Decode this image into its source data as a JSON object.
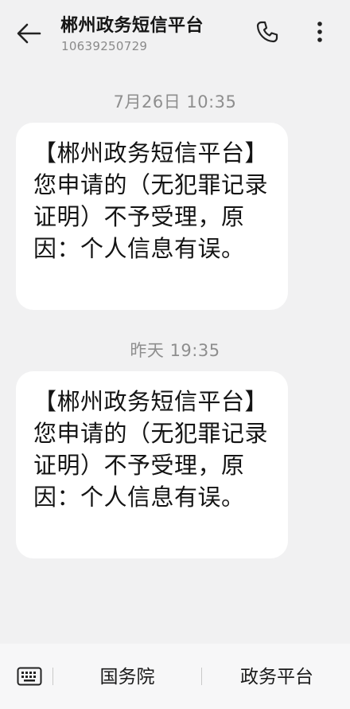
{
  "header": {
    "title": "郴州政务短信平台",
    "phone_number": "10639250729",
    "back_icon": "back-arrow-icon",
    "call_icon": "phone-icon",
    "more_icon": "more-vertical-icon"
  },
  "messages": [
    {
      "time": "7月26日 10:35",
      "text": "【郴州政务短信平台】您申请的（无犯罪记录证明）不予受理，原因：个人信息有误。"
    },
    {
      "time": "昨天 19:35",
      "text": "【郴州政务短信平台】您申请的（无犯罪记录证明）不予受理，原因：个人信息有误。"
    }
  ],
  "bottom_bar": {
    "keyboard_icon": "keyboard-icon",
    "menu": [
      "国务院",
      "政务平台"
    ]
  },
  "colors": {
    "background": "#f1f1f2",
    "bubble": "#ffffff",
    "timestamp": "#8e8e8e"
  }
}
